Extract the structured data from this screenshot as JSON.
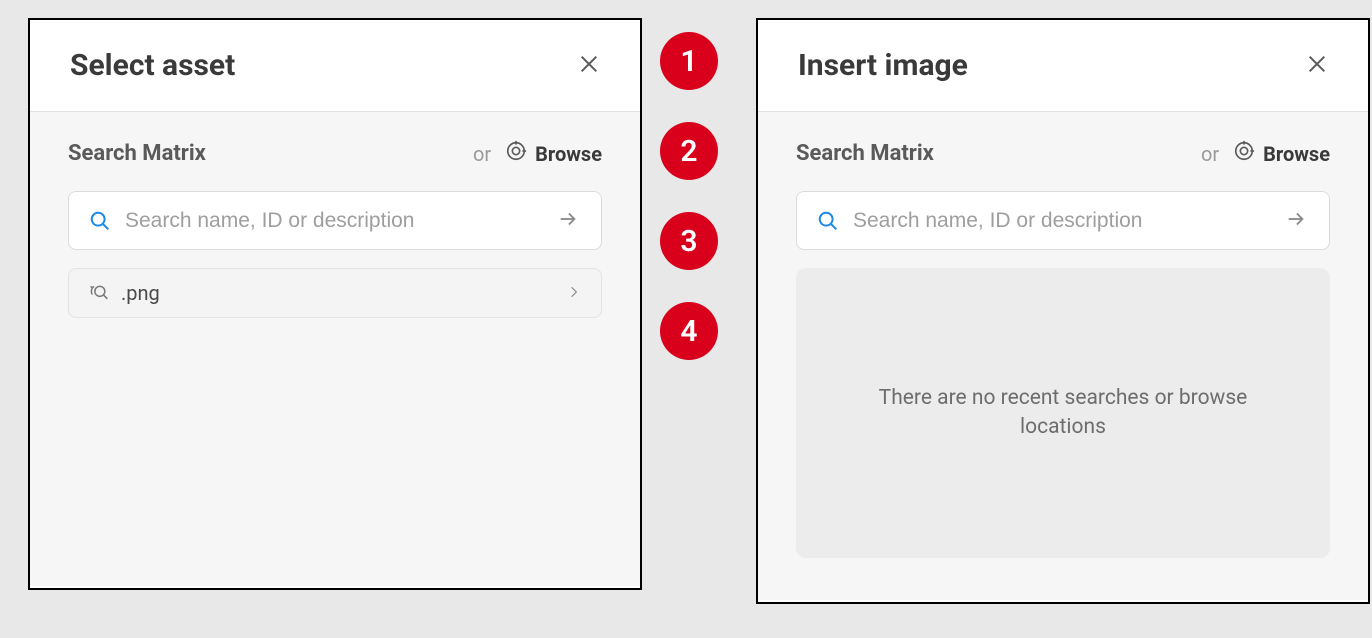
{
  "left_panel": {
    "title": "Select asset",
    "search_header": "Search Matrix",
    "or_label": "or",
    "browse_label": "Browse",
    "search_placeholder": "Search name, ID or description",
    "recent_item": ".png"
  },
  "right_panel": {
    "title": "Insert image",
    "search_header": "Search Matrix",
    "or_label": "or",
    "browse_label": "Browse",
    "search_placeholder": "Search name, ID or description",
    "empty_message": "There are no recent searches or browse locations"
  },
  "badges": {
    "b1": "1",
    "b2": "2",
    "b3": "3",
    "b4": "4"
  }
}
